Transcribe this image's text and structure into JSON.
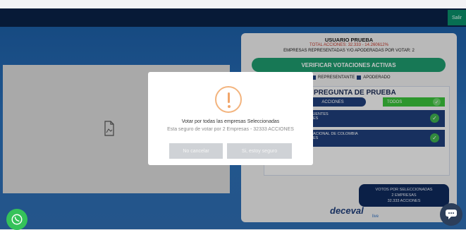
{
  "header": {
    "logout_label": "Salir"
  },
  "left_panel": {
    "doc_icon": "document-icon"
  },
  "right_panel": {
    "user_title": "USUARIO PRUEBA",
    "total_actions": "TOTAL ACCIONES: 32.333 - 14.260612%",
    "companies_line": "EMPRESAS REPRESENTADAS Y/O APODERADAS POR VOTAR: 2",
    "verify_button": "VERIFICAR VOTACIONES ACTIVAS",
    "legend_representante": "REPRESENTANTE",
    "legend_apoderado": "APODERADO",
    "question_title": "PREGUNTA DE PRUEBA",
    "toggle_acciones": "ACCIONES",
    "toggle_todos": "TODOS",
    "companies": [
      {
        "line1": "FUENTES",
        "line2": "NES"
      },
      {
        "line1": "NACIONAL DE COLOMBIA",
        "line2": "NES"
      }
    ],
    "votes_box": {
      "line1": "VOTOS POR SELECCIONADAS",
      "line2": "2 EMPRESAS",
      "line3": "32.333 ACCIONES"
    },
    "brand": "deceval",
    "brand_sub": "live"
  },
  "modal": {
    "title": "Votar por todas las empresas Seleccionadas",
    "message": "Esta seguro de votar por 2 Empresas - 32333 ACCIONES",
    "cancel_label": "No cancelar",
    "confirm_label": "Si, estoy seguro"
  },
  "colors": {
    "navy": "#0a2247",
    "green": "#1e9a6e",
    "warning": "#f1a56a"
  }
}
